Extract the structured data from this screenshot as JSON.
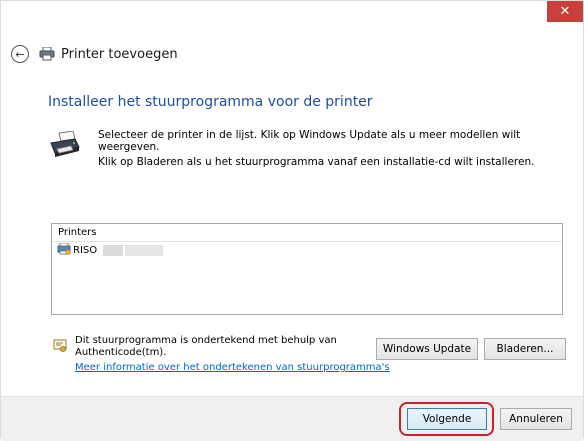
{
  "window": {
    "close_glyph": "✕"
  },
  "nav": {
    "back_icon": "back-arrow-icon",
    "title": "Printer toevoegen"
  },
  "main": {
    "heading": "Installeer het stuurprogramma voor de printer",
    "instruction1": "Selecteer de printer in de lijst. Klik op Windows Update als u meer modellen wilt weergeven.",
    "instruction2": "Klik op Bladeren als u het stuurprogramma vanaf een installatie-cd wilt installeren.",
    "list": {
      "header": "Printers",
      "items": [
        {
          "label": "RISO"
        }
      ]
    },
    "signature": {
      "text": "Dit stuurprogramma is ondertekend met behulp van Authenticode(tm).",
      "link": "Meer informatie over het ondertekenen van stuurprogramma's"
    },
    "buttons": {
      "windows_update": "Windows Update",
      "browse": "Bladeren..."
    }
  },
  "footer": {
    "next": "Volgende",
    "cancel": "Annuleren"
  },
  "colors": {
    "heading": "#1e4d9c",
    "link": "#0066cc",
    "close_bg": "#c7403a",
    "highlight": "#c0262b"
  }
}
